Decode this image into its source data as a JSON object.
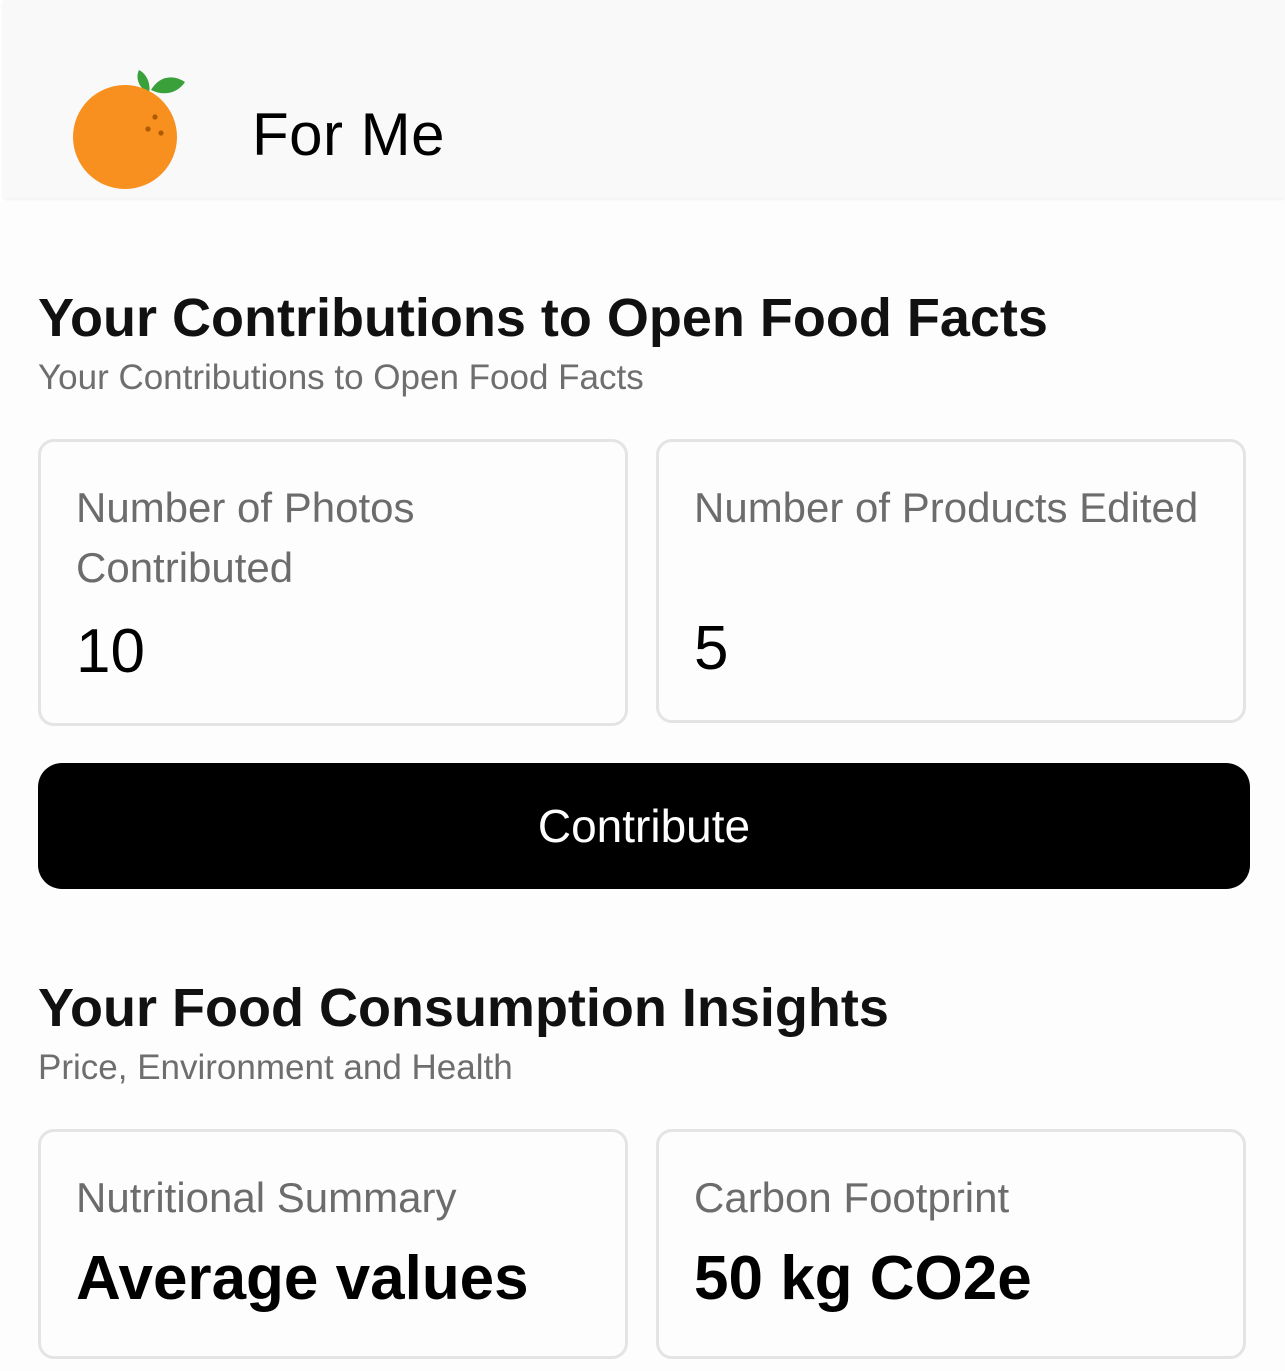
{
  "header": {
    "title": "For Me",
    "logo_icon": "orange-fruit-icon"
  },
  "contributions": {
    "title": "Your Contributions to Open Food Facts",
    "subtitle": "Your Contributions to Open Food Facts",
    "cards": [
      {
        "label": "Number of Photos Contributed",
        "value": "10"
      },
      {
        "label": "Number of Products Edited",
        "value": "5"
      }
    ],
    "button_label": "Contribute"
  },
  "insights": {
    "title": "Your Food Consumption Insights",
    "subtitle": "Price, Environment and Health",
    "cards": [
      {
        "label": "Nutritional Summary",
        "value": "Average values"
      },
      {
        "label": "Carbon Footprint",
        "value": "50 kg CO2e"
      }
    ]
  },
  "colors": {
    "orange": "#f7901e",
    "leaf": "#3aa03a",
    "button_background": "#000000",
    "button_text": "#ffffff"
  }
}
